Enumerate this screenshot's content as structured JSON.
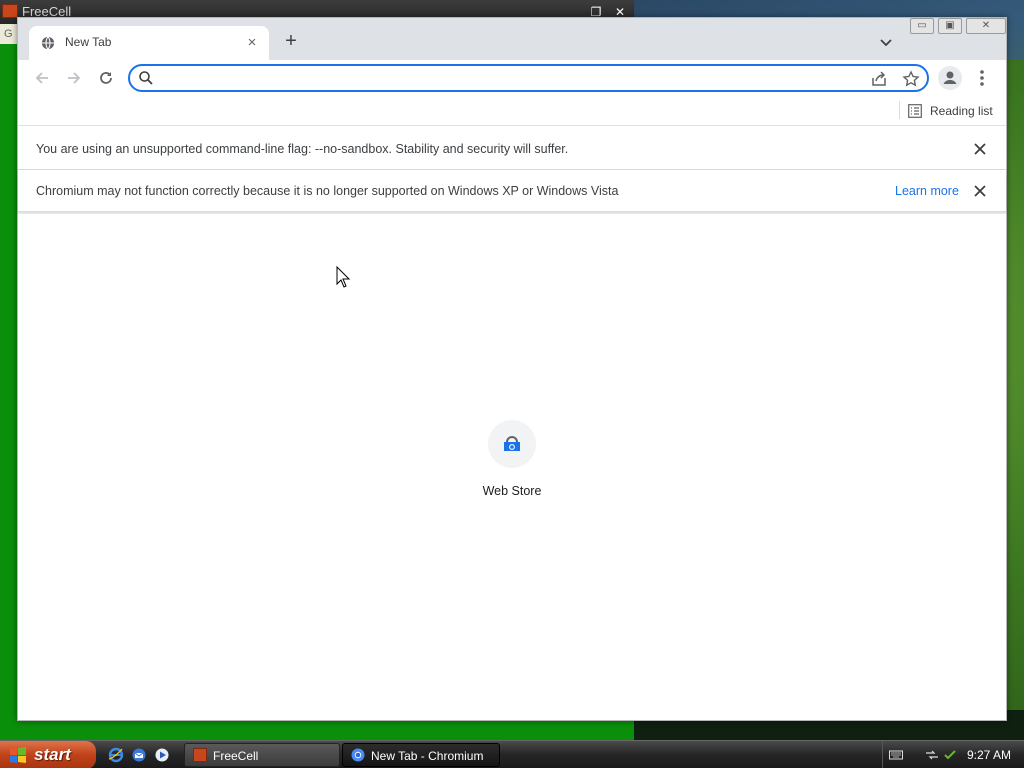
{
  "freecell": {
    "title": "FreeCell",
    "menu_fragment": "G",
    "minimize": "_",
    "maximize": "❐",
    "close": "✕"
  },
  "browser": {
    "tab": {
      "title": "New Tab",
      "close": "×"
    },
    "new_tab": "+",
    "omnibox": {
      "value": "",
      "placeholder": ""
    },
    "bookmarks_bar": {
      "reading_list": "Reading list"
    },
    "infobars": [
      {
        "text": "You are using an unsupported command-line flag: --no-sandbox. Stability and security will suffer."
      },
      {
        "text": "Chromium may not function correctly because it is no longer supported on Windows XP or Windows Vista",
        "link": "Learn more"
      }
    ],
    "ntp": {
      "shortcuts": [
        {
          "label": "Web Store",
          "icon": "web-store-icon"
        }
      ]
    }
  },
  "taskbar": {
    "start": "start",
    "tasks": [
      {
        "label": "FreeCell",
        "icon": "freecell-icon",
        "active": false
      },
      {
        "label": "New Tab - Chromium",
        "icon": "chromium-icon",
        "active": true
      }
    ],
    "clock": "9:27 AM"
  },
  "colors": {
    "accent": "#1a73e8",
    "tabstrip": "#dee1e6",
    "freecell_green": "#0a8f0a",
    "start_orange": "#c0421a"
  }
}
